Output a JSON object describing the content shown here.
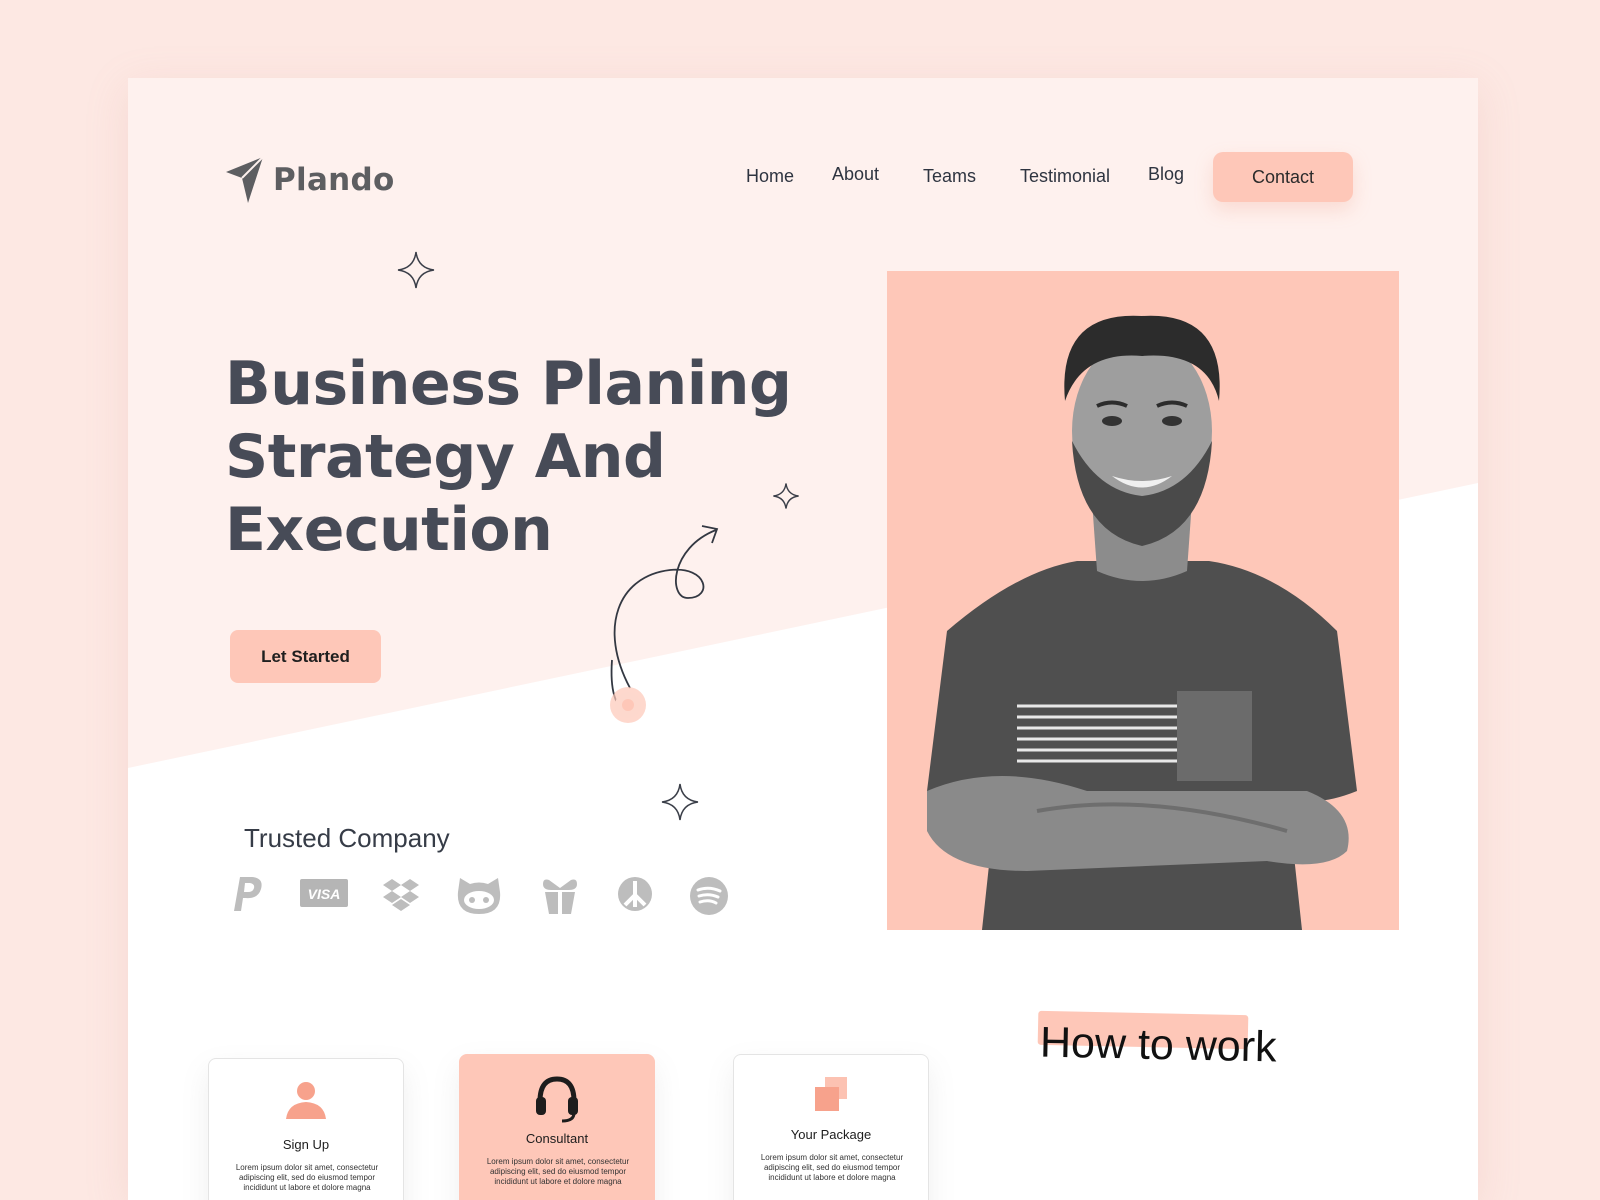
{
  "brand": {
    "name": "Plando",
    "logo_icon": "paper-plane-icon"
  },
  "nav": {
    "items": [
      {
        "label": "Home"
      },
      {
        "label": "About"
      },
      {
        "label": "Teams"
      },
      {
        "label": "Testimonial"
      },
      {
        "label": "Blog"
      }
    ],
    "contact_label": "Contact"
  },
  "hero": {
    "title_lines": [
      "Business Planing",
      "Strategy And",
      "Execution"
    ],
    "cta_label": "Let Started"
  },
  "trusted": {
    "title": "Trusted Company",
    "brands": [
      "paypal-icon",
      "visa-icon",
      "dropbox-icon",
      "github-icon",
      "gift-icon",
      "peace-icon",
      "spotify-icon"
    ],
    "visa_text": "VISA"
  },
  "how_to_work": {
    "title": "How to work",
    "cards": [
      {
        "title": "Sign Up",
        "icon": "user-icon",
        "text": "Lorem ipsum dolor sit amet, consectetur adipiscing elit, sed do eiusmod tempor incididunt ut labore et dolore magna"
      },
      {
        "title": "Consultant",
        "icon": "headset-icon",
        "text": "Lorem ipsum dolor sit amet, consectetur adipiscing elit, sed do eiusmod tempor incididunt ut labore et dolore magna"
      },
      {
        "title": "Your Package",
        "icon": "package-icon",
        "text": "Lorem ipsum dolor sit amet, consectetur adipiscing elit, sed do eiusmod tempor incididunt ut labore et dolore magna"
      }
    ]
  },
  "colors": {
    "accent": "#fec7b8",
    "background": "#fde8e3",
    "hero_bg": "#fef1ee",
    "heading": "#474b57",
    "logo": "#5d5e61",
    "brand_gray": "#b5b5b5"
  }
}
